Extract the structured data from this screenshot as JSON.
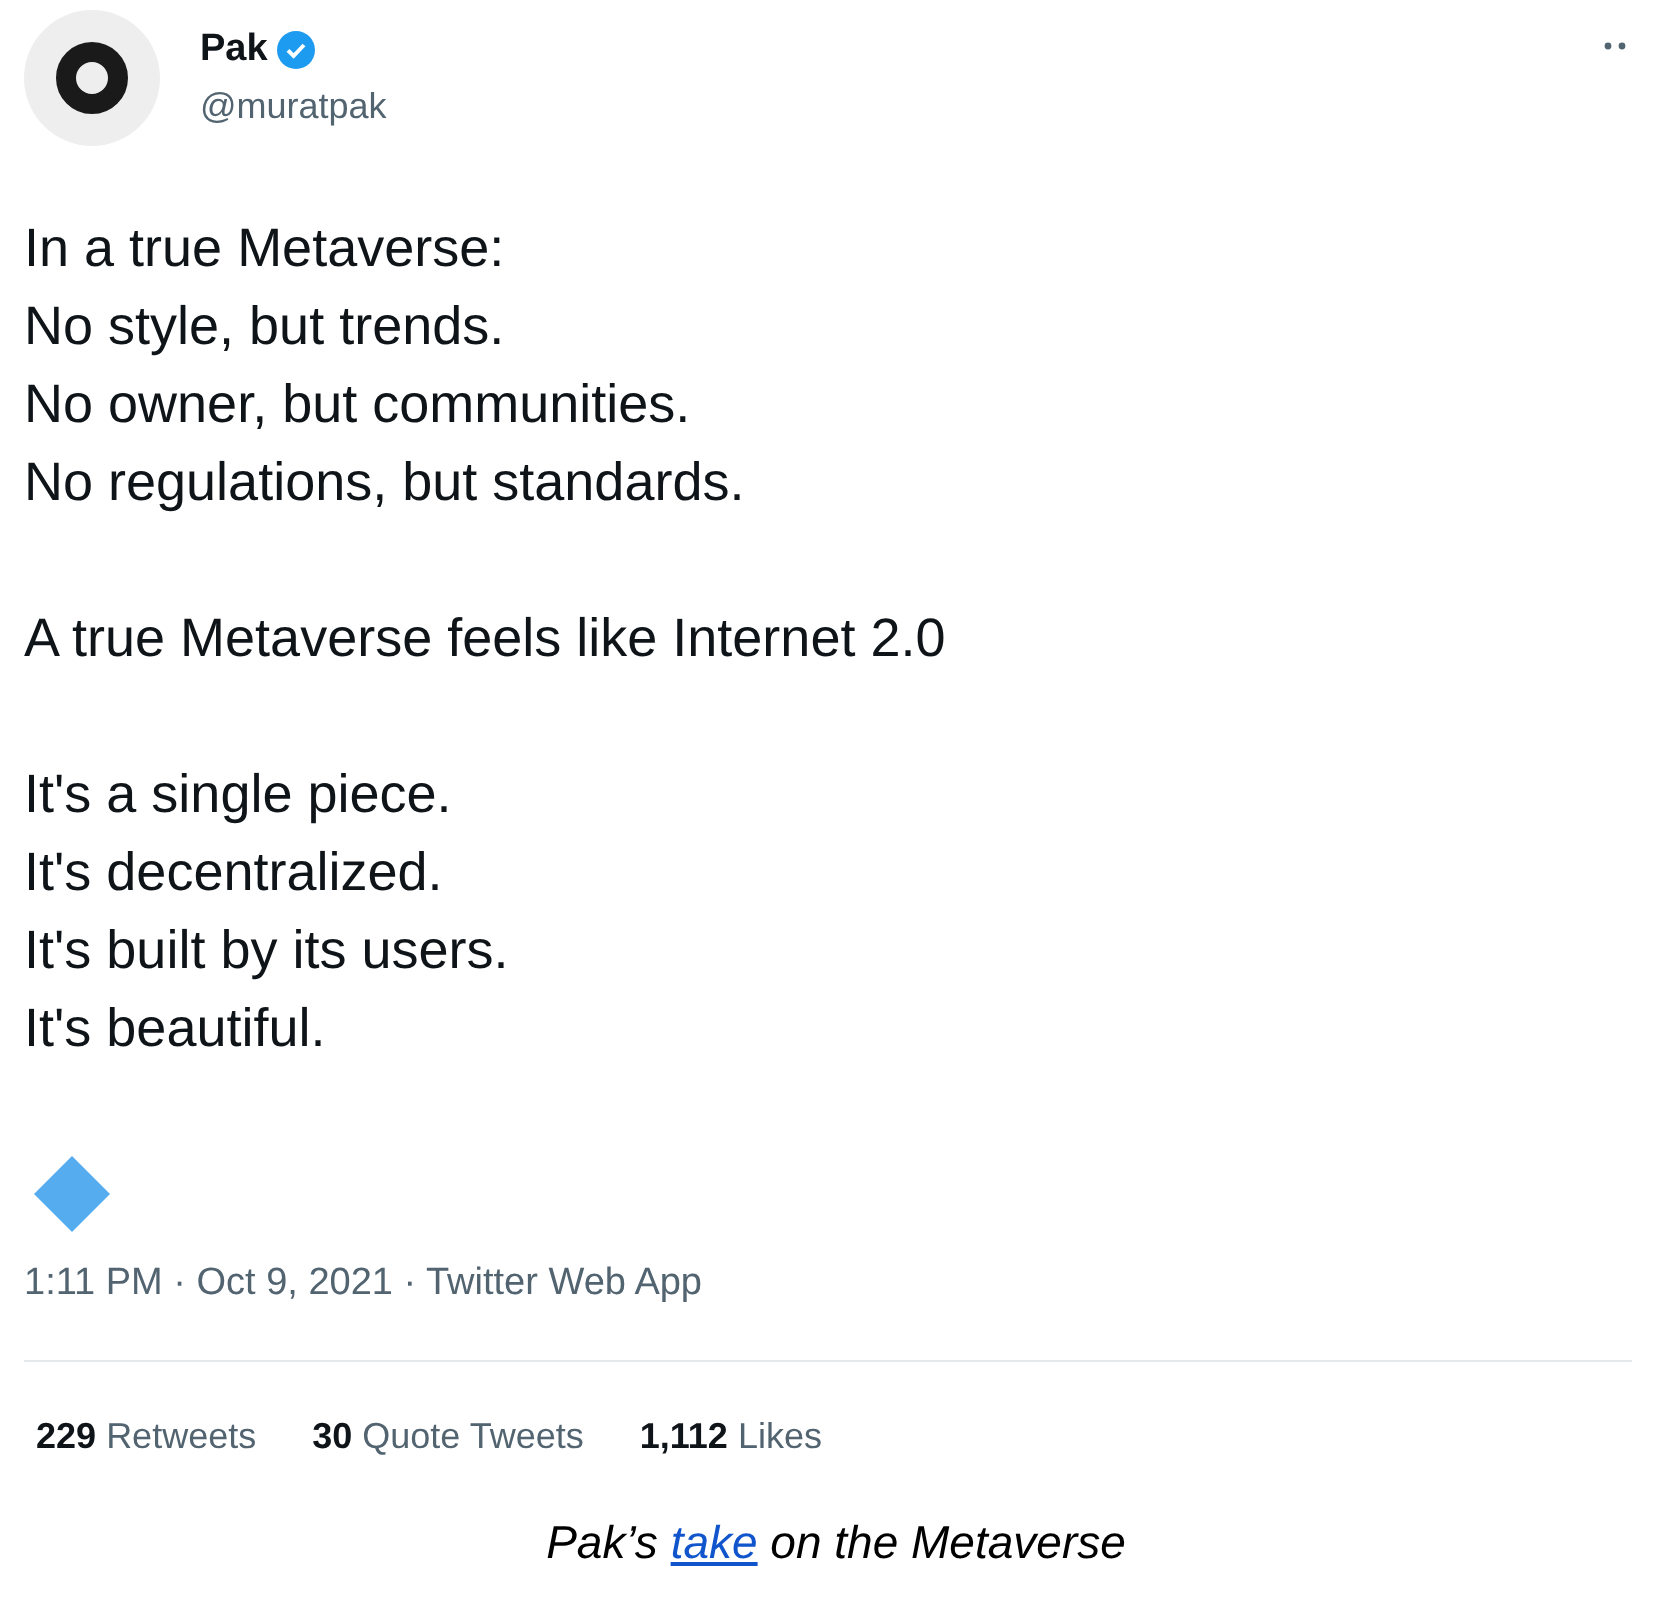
{
  "tweet": {
    "author": {
      "name": "Pak",
      "verified": true,
      "handle": "@muratpak"
    },
    "paragraphs": [
      [
        "In a true Metaverse:",
        "No style, but trends.",
        "No owner, but communities.",
        "No regulations, but standards."
      ],
      [
        "A true Metaverse feels like Internet 2.0"
      ],
      [
        "It's a single piece.",
        "It's decentralized.",
        "It's built by its users.",
        "It's beautiful."
      ]
    ],
    "meta": "1:11 PM · Oct 9, 2021 · Twitter Web App",
    "stats": [
      {
        "count": "229",
        "label": "Retweets"
      },
      {
        "count": "30",
        "label": "Quote Tweets"
      },
      {
        "count": "1,112",
        "label": "Likes"
      }
    ]
  },
  "caption": {
    "before": "Pak’s ",
    "link": "take",
    "after": " on the Metaverse"
  }
}
